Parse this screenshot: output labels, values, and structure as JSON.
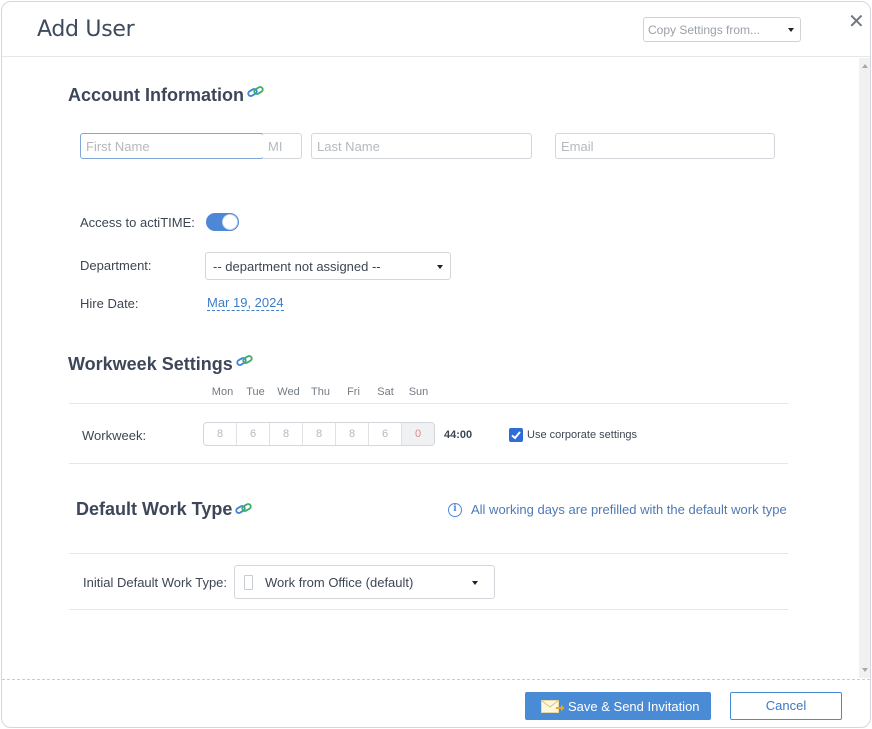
{
  "dialog": {
    "title": "Add User",
    "copy_settings_placeholder": "Copy Settings from...",
    "close_icon": "close-icon"
  },
  "account": {
    "title": "Account Information",
    "link_icon": "link-icon",
    "first_name_placeholder": "First Name",
    "mi_placeholder": "MI",
    "last_name_placeholder": "Last Name",
    "email_placeholder": "Email",
    "first_name_value": "",
    "mi_value": "",
    "last_name_value": "",
    "email_value": "",
    "access_label": "Access to actiTIME:",
    "access_enabled": true,
    "department_label": "Department:",
    "department_value": "-- department not assigned --",
    "hire_date_label": "Hire Date:",
    "hire_date_value": "Mar 19, 2024"
  },
  "workweek": {
    "title": "Workweek Settings",
    "link_icon": "link-icon",
    "days": [
      "Mon",
      "Tue",
      "Wed",
      "Thu",
      "Fri",
      "Sat",
      "Sun"
    ],
    "label": "Workweek:",
    "hours": [
      "8",
      "6",
      "8",
      "8",
      "8",
      "6",
      "0"
    ],
    "total": "44:00",
    "use_corporate_label": "Use corporate settings",
    "use_corporate_checked": true
  },
  "work_type": {
    "title": "Default Work Type",
    "link_icon": "link-icon",
    "info_icon": "info-icon",
    "info_text": "All working days are prefilled with the default work type",
    "initial_label": "Initial Default Work Type:",
    "initial_value": "Work from Office (default)"
  },
  "footer": {
    "save_label": "Save & Send Invitation",
    "save_icon": "mail-send-icon",
    "cancel_label": "Cancel"
  },
  "colors": {
    "accent": "#4a8bd6",
    "link": "#3f7bc8",
    "toggle_on": "#4f87d7",
    "weekend_value": "#e08a86"
  }
}
